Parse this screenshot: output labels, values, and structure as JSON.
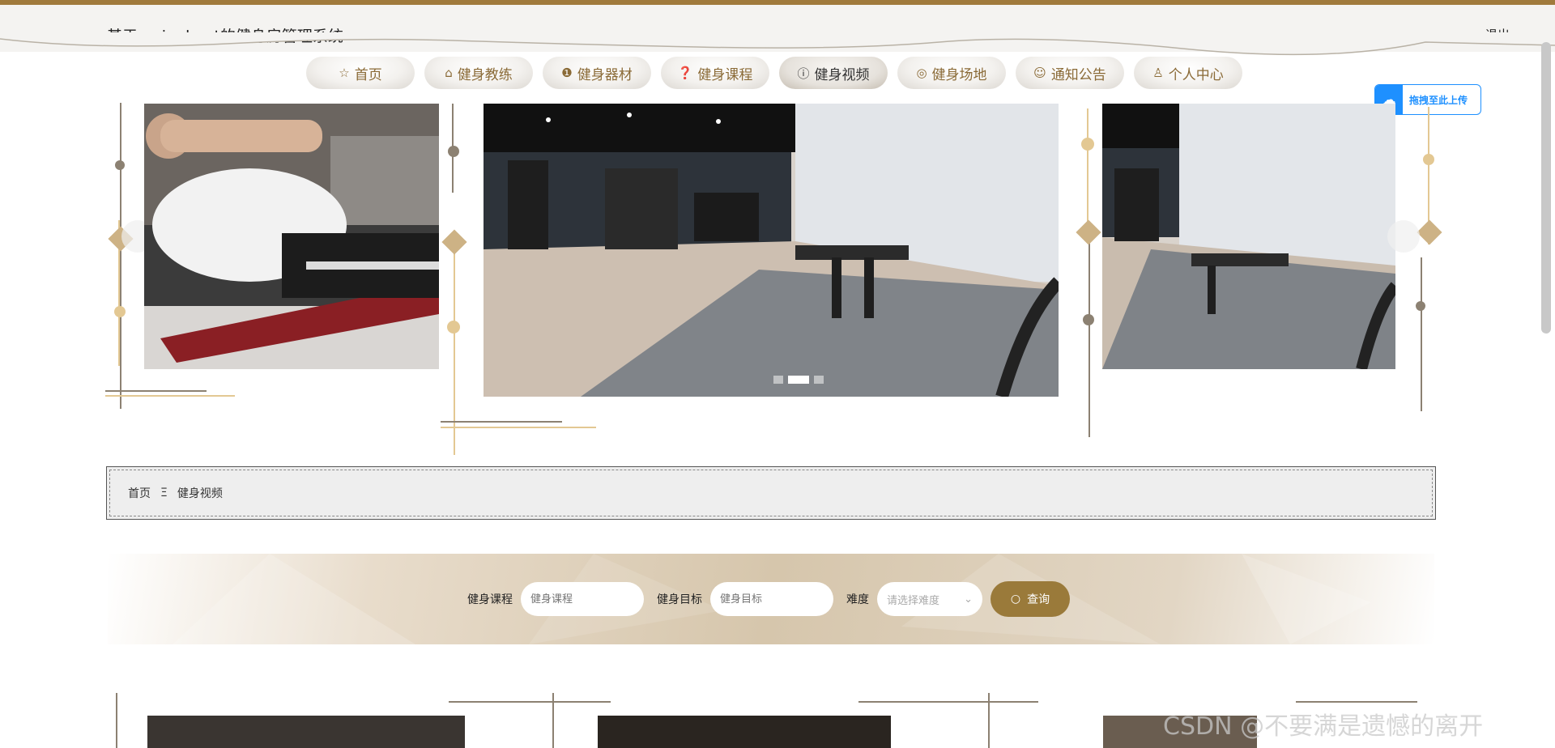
{
  "header": {
    "title": "基于springboot的健身房管理系统",
    "logout": "退出"
  },
  "nav": {
    "items": [
      {
        "label": "首页",
        "icon": "star-icon"
      },
      {
        "label": "健身教练",
        "icon": "bag-icon"
      },
      {
        "label": "健身器材",
        "icon": "alert-icon"
      },
      {
        "label": "健身课程",
        "icon": "question-icon"
      },
      {
        "label": "健身视频",
        "icon": "info-icon"
      },
      {
        "label": "健身场地",
        "icon": "ring-icon"
      },
      {
        "label": "通知公告",
        "icon": "smile-icon"
      },
      {
        "label": "个人中心",
        "icon": "user-icon"
      }
    ],
    "active": "健身视频"
  },
  "upload_badge": {
    "label": "拖拽至此上传"
  },
  "carousel": {
    "slide_count": 3,
    "active_index": 1
  },
  "breadcrumb": {
    "home": "首页",
    "separator": "Ξ",
    "current": "健身视频"
  },
  "search": {
    "course_label": "健身课程",
    "course_placeholder": "健身课程",
    "goal_label": "健身目标",
    "goal_placeholder": "健身目标",
    "difficulty_label": "难度",
    "difficulty_placeholder": "请选择难度",
    "button": "查询"
  },
  "watermark": "CSDN @不要满是遗憾的离开",
  "colors": {
    "accent": "#9a7a3a",
    "top_bar": "#a07a3c",
    "nav_text": "#8a6a36",
    "upload_blue": "#1e90ff"
  }
}
